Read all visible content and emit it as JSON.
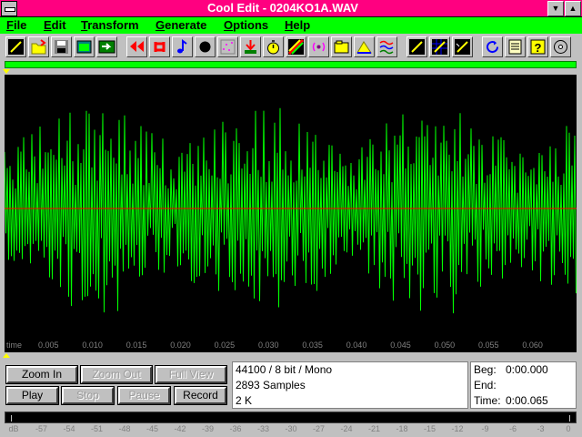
{
  "window": {
    "title": "Cool Edit - 0204KO1A.WAV",
    "minimize_glyph": "▼",
    "maximize_glyph": "▲"
  },
  "menu": [
    {
      "label": "File"
    },
    {
      "label": "Edit"
    },
    {
      "label": "Transform"
    },
    {
      "label": "Generate"
    },
    {
      "label": "Options"
    },
    {
      "label": "Help"
    }
  ],
  "toolbar": {
    "icons": [
      "new-icon",
      "open-icon",
      "save-icon",
      "window-icon",
      "insert-icon",
      "rewind-icon",
      "loop-icon",
      "note-icon",
      "record-dot-icon",
      "scatter-icon",
      "download-icon",
      "stopwatch-icon",
      "spectrum-icon",
      "broadcast-icon",
      "folder-icon",
      "envelope-icon",
      "waves-icon",
      "pencil-icon",
      "grid-icon",
      "pencil-check-icon",
      "refresh-icon",
      "notes-icon",
      "help-icon",
      "cd-icon"
    ]
  },
  "colors": {
    "title_bar": "#ff0080",
    "menu_bar": "#00ff00",
    "waveform": "#00ff00",
    "centerline": "#ff0000",
    "marker": "#ffff00"
  },
  "time_ruler": {
    "name": "time",
    "ticks": [
      "0.005",
      "0.010",
      "0.015",
      "0.020",
      "0.025",
      "0.030",
      "0.035",
      "0.040",
      "0.045",
      "0.050",
      "0.055",
      "0.060"
    ]
  },
  "buttons": {
    "zoom_in": "Zoom In",
    "zoom_out": "Zoom Out",
    "full_view": "Full View",
    "play": "Play",
    "stop": "Stop",
    "pause": "Pause",
    "record": "Record"
  },
  "info": {
    "format": "44100 / 8 bit / Mono",
    "samples": "2893 Samples",
    "size": "2 K"
  },
  "selection": {
    "beg_label": "Beg:",
    "beg_value": "0:00.000",
    "end_label": "End:",
    "end_value": "",
    "time_label": "Time:",
    "time_value": "0:00.065"
  },
  "level_scale": [
    "dB",
    "-57",
    "-54",
    "-51",
    "-48",
    "-45",
    "-42",
    "-39",
    "-36",
    "-33",
    "-30",
    "-27",
    "-24",
    "-21",
    "-18",
    "-15",
    "-12",
    "-9",
    "-6",
    "-3",
    "0"
  ]
}
